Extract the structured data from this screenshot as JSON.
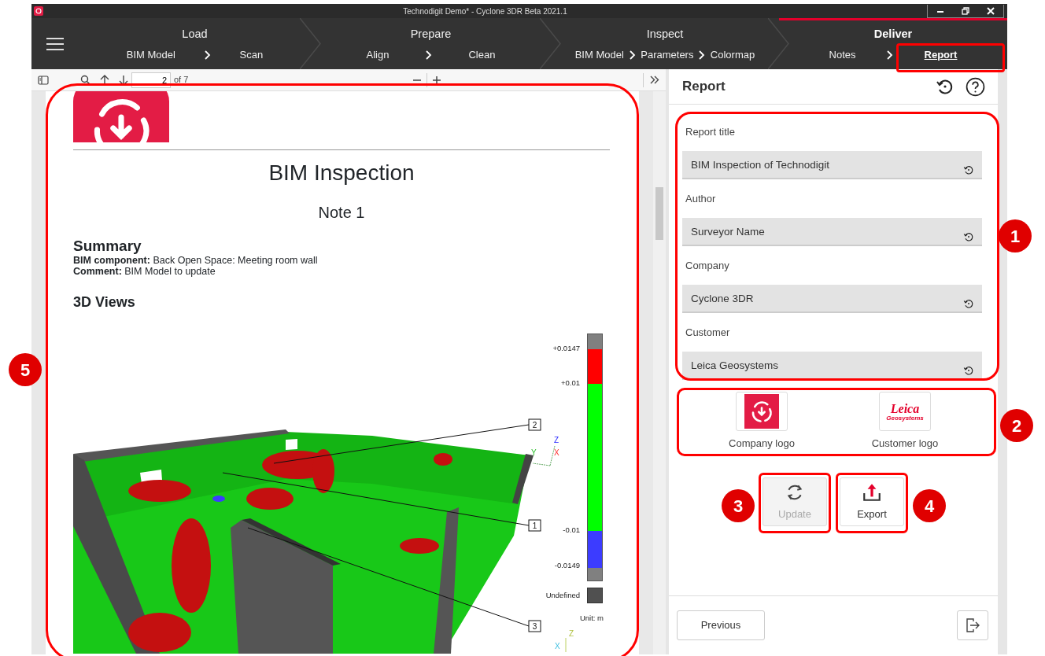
{
  "window": {
    "title": "Technodigit Demo* - Cyclone 3DR Beta 2021.1"
  },
  "workflow": [
    {
      "label": "Load",
      "selected": false,
      "substeps": [
        {
          "label": "BIM Model",
          "selected": false
        },
        {
          "label": "Scan",
          "selected": false
        }
      ]
    },
    {
      "label": "Prepare",
      "selected": false,
      "substeps": [
        {
          "label": "Align",
          "selected": false
        },
        {
          "label": "Clean",
          "selected": false
        }
      ]
    },
    {
      "label": "Inspect",
      "selected": false,
      "substeps": [
        {
          "label": "BIM Model",
          "selected": false
        },
        {
          "label": "Parameters",
          "selected": false
        },
        {
          "label": "Colormap",
          "selected": false
        }
      ]
    },
    {
      "label": "Deliver",
      "selected": true,
      "substeps": [
        {
          "label": "Notes",
          "selected": false
        },
        {
          "label": "Report",
          "selected": true
        }
      ]
    }
  ],
  "viewer": {
    "page": "2",
    "page_count": "of 7",
    "document": {
      "title": "BIM Inspection",
      "subtitle": "Note 1",
      "summary_heading": "Summary",
      "summary_lines": [
        "**BIM component:** Back Open Space: Meeting room wall",
        "**Comment:** BIM Model to update"
      ],
      "views_heading": "3D Views",
      "figure": {
        "tags": [
          "2",
          "1",
          "3"
        ],
        "axes_top": [
          "Z",
          "Y",
          "X"
        ],
        "axes_bottom": [
          "Z",
          "X"
        ],
        "legend": {
          "segments": [
            {
              "color": "#808080"
            },
            {
              "color": "#ff0000"
            },
            {
              "color": "#00ff00"
            },
            {
              "color": "#3c3cff"
            },
            {
              "color": "#808080"
            }
          ],
          "ticks": [
            "+0.0147",
            "+0.01",
            "-0.01",
            "-0.0149"
          ],
          "undefined_label": "Undefined",
          "unit": "Unit: m"
        }
      }
    }
  },
  "panel": {
    "title": "Report",
    "fields": [
      {
        "label": "Report title",
        "value": "BIM Inspection of Technodigit"
      },
      {
        "label": "Author",
        "value": "Surveyor Name"
      },
      {
        "label": "Company",
        "value": "Cyclone 3DR"
      },
      {
        "label": "Customer",
        "value": "Leica Geosystems"
      }
    ],
    "logos": [
      {
        "kind": "company",
        "caption": "Company logo"
      },
      {
        "kind": "customer",
        "caption": "Customer logo",
        "text": "Leica",
        "subtext": "Geosystems"
      }
    ],
    "actions": [
      {
        "kind": "update",
        "label": "Update",
        "disabled": true
      },
      {
        "kind": "export",
        "label": "Export",
        "disabled": false
      }
    ],
    "previous": "Previous"
  },
  "callouts": [
    "1",
    "2",
    "3",
    "4",
    "5"
  ]
}
